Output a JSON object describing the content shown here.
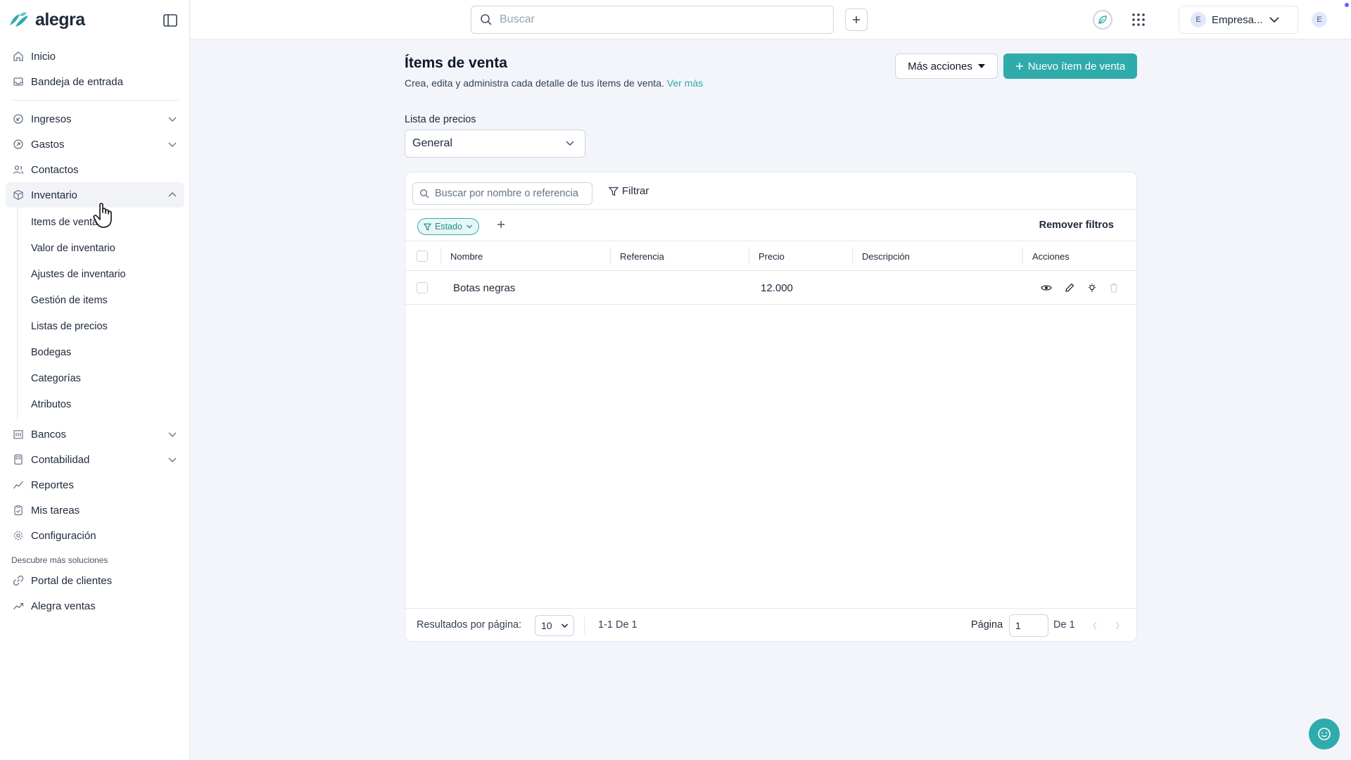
{
  "brand": {
    "name": "alegra",
    "color": "#30abac"
  },
  "sidebar": {
    "items_top": [
      {
        "label": "Inicio",
        "icon": "home-icon"
      },
      {
        "label": "Bandeja de entrada",
        "icon": "inbox-icon"
      }
    ],
    "items_main": [
      {
        "label": "Ingresos",
        "icon": "income-icon",
        "expandable": true
      },
      {
        "label": "Gastos",
        "icon": "expense-icon",
        "expandable": true
      },
      {
        "label": "Contactos",
        "icon": "contacts-icon",
        "expandable": false
      },
      {
        "label": "Inventario",
        "icon": "box-icon",
        "expandable": true,
        "expanded": true
      }
    ],
    "inventory_sub": [
      "Items de venta",
      "Valor de inventario",
      "Ajustes de inventario",
      "Gestión de items",
      "Listas de precios",
      "Bodegas",
      "Categorías",
      "Atributos"
    ],
    "items_bottom": [
      {
        "label": "Bancos",
        "icon": "bank-icon",
        "expandable": true
      },
      {
        "label": "Contabilidad",
        "icon": "accounting-icon",
        "expandable": true
      },
      {
        "label": "Reportes",
        "icon": "chart-line-icon",
        "expandable": false
      },
      {
        "label": "Mis tareas",
        "icon": "clipboard-icon",
        "expandable": false
      },
      {
        "label": "Configuración",
        "icon": "gear-icon",
        "expandable": false
      }
    ],
    "discover_label": "Descubre más soluciones",
    "discover_items": [
      {
        "label": "Portal de clientes",
        "icon": "link-icon"
      },
      {
        "label": "Alegra ventas",
        "icon": "trend-up-icon"
      }
    ]
  },
  "topbar": {
    "search_placeholder": "Buscar",
    "company_initial": "E",
    "company_name": "Empresa...",
    "user_initial": "E"
  },
  "page": {
    "title": "Ítems de venta",
    "subtitle": "Crea, edita y administra cada detalle de tus ítems de venta.",
    "subtitle_link": "Ver más",
    "more_actions": "Más acciones",
    "new_item": "Nuevo ítem de venta",
    "price_list_label": "Lista de precios",
    "price_list_value": "General"
  },
  "table": {
    "search_placeholder": "Buscar por nombre o referencia",
    "filter_label": "Filtrar",
    "chip_label": "Estado",
    "remove_filters": "Remover filtros",
    "columns": [
      "Nombre",
      "Referencia",
      "Precio",
      "Descripción",
      "Acciones"
    ],
    "rows": [
      {
        "nombre": "Botas negras",
        "referencia": "",
        "precio": "12.000",
        "descripcion": ""
      }
    ]
  },
  "footer": {
    "per_page_label": "Resultados por página:",
    "per_page_value": "10",
    "range": "1-1 De 1",
    "page_label": "Página",
    "page_value": "1",
    "of_pages": "De 1"
  }
}
